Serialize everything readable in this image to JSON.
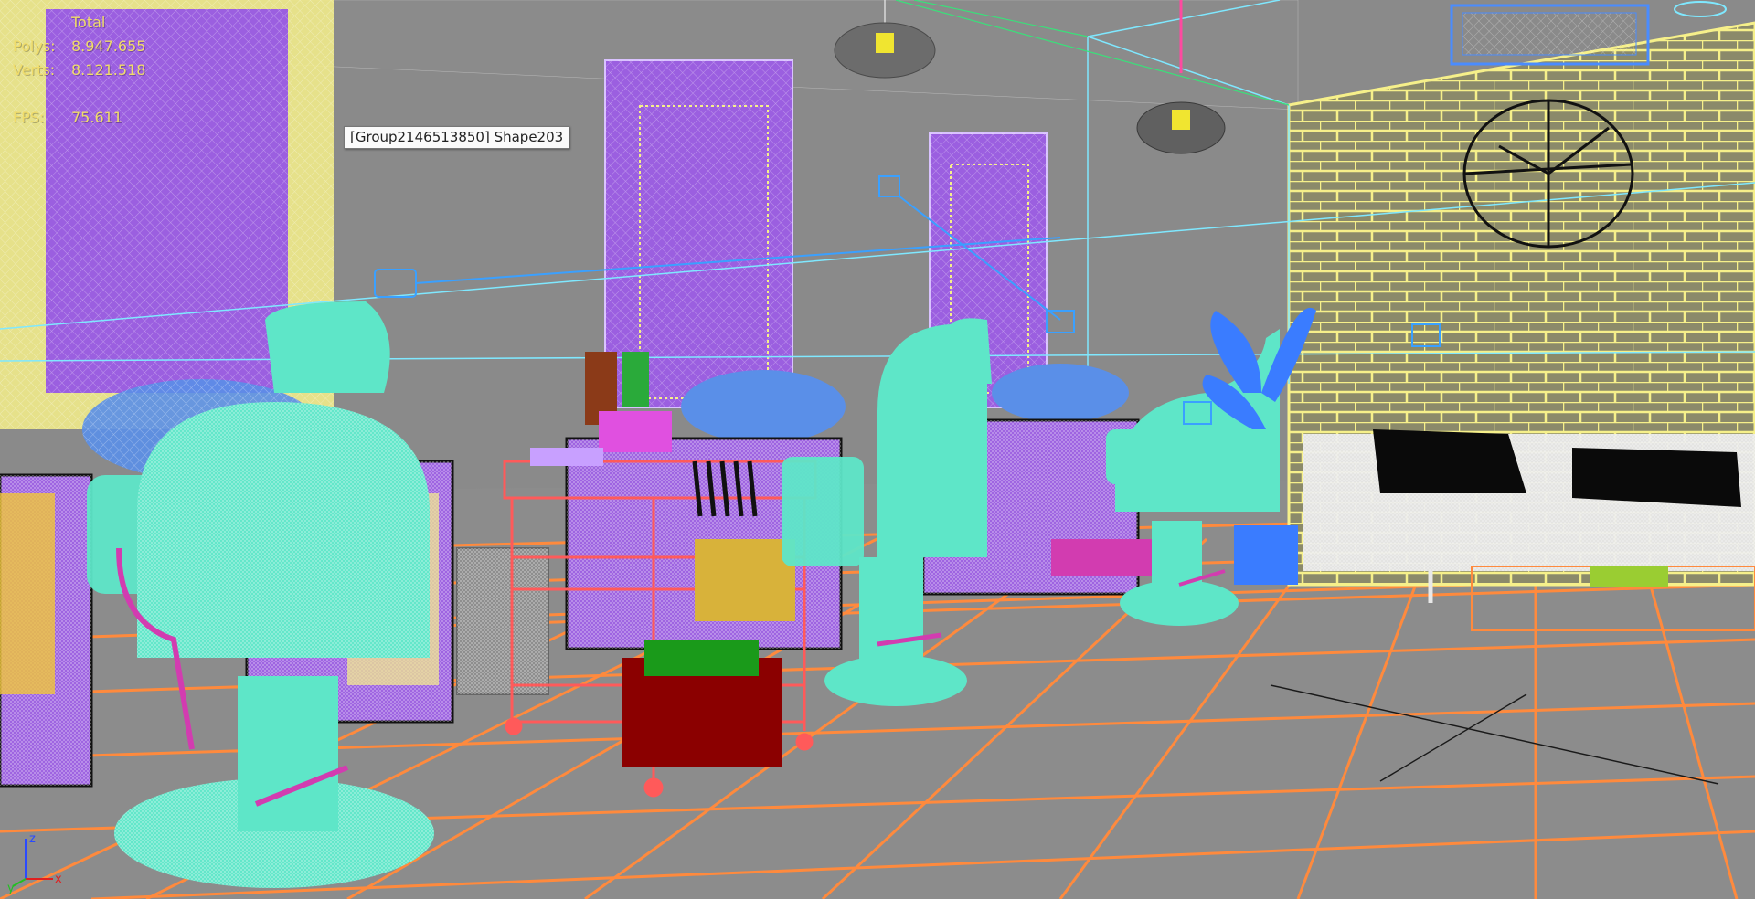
{
  "viewport": {
    "stats": {
      "header": "Total",
      "rows": [
        {
          "label": "Polys:",
          "value": "8.947.655"
        },
        {
          "label": "Verts:",
          "value": "8.121.518"
        },
        {
          "label": "FPS:",
          "value": "75.611"
        }
      ]
    },
    "tooltip": "[Group2146513850] Shape203",
    "axis": {
      "z": "z",
      "y": "y",
      "x": "x"
    }
  },
  "colors": {
    "background": "#8a8a8a",
    "floor_grid": "#ff8a3d",
    "chair": "#5ee6c8",
    "mirror": "#9b5fe0",
    "wall_yellow": "#f6f08a",
    "cart": "#ff5a5a",
    "light": "#3aa0ff",
    "sofa": "#e8e8e8",
    "overlay_text": "#f0dc6a"
  },
  "icons": [
    "light-gizmo-icon",
    "camera-gizmo-icon",
    "axis-tripod-icon"
  ]
}
